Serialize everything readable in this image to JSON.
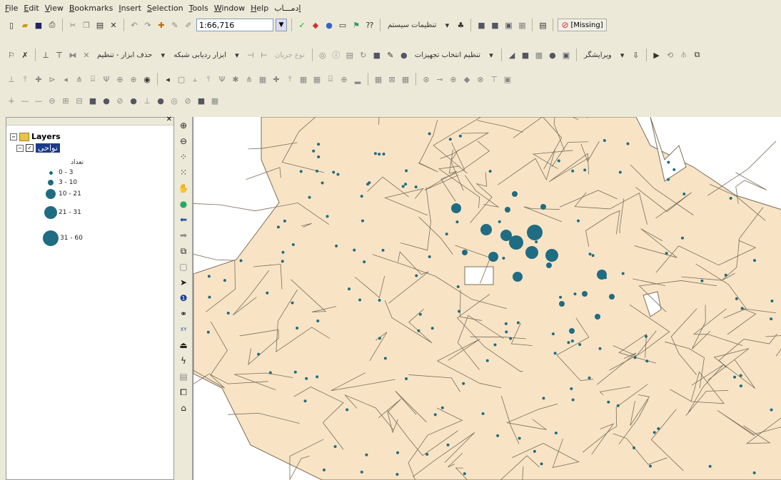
{
  "menu": {
    "items": [
      "File",
      "Edit",
      "View",
      "Bookmarks",
      "Insert",
      "Selection",
      "Tools",
      "Window",
      "Help"
    ],
    "extra_menu": "ادمـــاب"
  },
  "toolbar1": {
    "scale": "1:66,716",
    "system_settings": "تنظیمات سیستم",
    "missing_label": "[Missing]"
  },
  "toolbar2": {
    "select_equipment_setting": "تنظیم انتخاب تجهیزات",
    "network_tracking_tools": "ابزار ردیابی شبکه",
    "delete_tools": "حذف ابزار - تنظیم",
    "flow_direction": "نوع جریان",
    "editor": "ویرایشگر"
  },
  "toc": {
    "root_label": "Layers",
    "layer_name": "نواحی",
    "legend_title": "تعداد",
    "legend": [
      {
        "label": "0  - 3",
        "size": 1
      },
      {
        "label": "3  - 10",
        "size": 2
      },
      {
        "label": "10  - 21",
        "size": 3
      },
      {
        "label": "21  - 31",
        "size": 4
      },
      {
        "label": "31  - 60",
        "size": 5
      }
    ]
  },
  "colors": {
    "polygon_fill": "#f8e4c5",
    "polygon_stroke": "#7a6e5c",
    "dot": "#1f6c83",
    "map_bg": "#ffffff"
  },
  "tools": [
    "zoom-in-icon",
    "zoom-out-icon",
    "fixed-zoom-in-icon",
    "fixed-zoom-out-icon",
    "pan-icon",
    "full-extent-icon",
    "back-icon",
    "forward-icon",
    "select-features-icon",
    "clear-selection-icon",
    "select-elements-icon",
    "identify-icon",
    "find-icon",
    "go-to-xy-icon",
    "measure-icon",
    "hyperlink-icon",
    "html-popup-icon",
    "viewer-icon",
    "time-slider-icon"
  ]
}
